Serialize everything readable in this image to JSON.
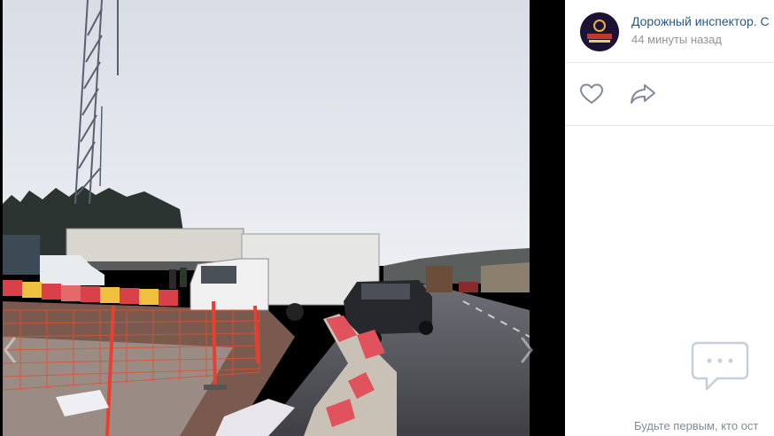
{
  "post": {
    "author": "Дорожный инспектор. С",
    "time": "44 минуты назад",
    "avatar_text": "ДОРОЖНЫЙ ИНСПЕКТОР"
  },
  "comments": {
    "empty_text": "Будьте первым, кто ост"
  },
  "icons": {
    "like": "heart-icon",
    "share": "share-arrow-icon",
    "comments": "comment-bubble-icon",
    "prev": "chevron-left-icon",
    "next": "chevron-right-icon"
  },
  "colors": {
    "link": "#2a5885",
    "muted": "#939393",
    "icon": "#828a99",
    "background": "#000000"
  }
}
